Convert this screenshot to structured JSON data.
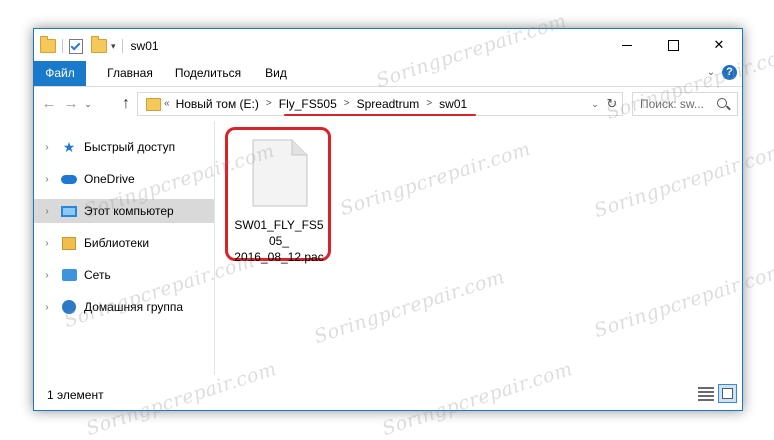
{
  "window": {
    "title": "sw01"
  },
  "ribbon": {
    "tabs": [
      {
        "label": "Файл",
        "active": true
      },
      {
        "label": "Главная"
      },
      {
        "label": "Поделиться"
      },
      {
        "label": "Вид"
      }
    ],
    "help": "?"
  },
  "address": {
    "lead": "«",
    "crumbs": [
      "Новый том (E:)",
      "Fly_FS505",
      "Spreadtrum",
      "sw01"
    ],
    "arrow": ">"
  },
  "search": {
    "placeholder": "Поиск: sw..."
  },
  "nav": {
    "items": [
      {
        "label": "Быстрый доступ",
        "icon": "star-icon"
      },
      {
        "label": "OneDrive",
        "icon": "cloud-icon"
      },
      {
        "label": "Этот компьютер",
        "icon": "computer-icon",
        "selected": true
      },
      {
        "label": "Библиотеки",
        "icon": "library-icon"
      },
      {
        "label": "Сеть",
        "icon": "network-icon"
      },
      {
        "label": "Домашняя группа",
        "icon": "homegroup-icon"
      }
    ]
  },
  "files": [
    {
      "name": "SW01_FLY_FS505_2016_08_12.pac",
      "name_lines": [
        "SW01_FLY_FS505_",
        "2016_08_12.pac"
      ],
      "icon": "document-file-icon"
    }
  ],
  "status": {
    "count": "1 элемент"
  },
  "watermark": "Soringpcrepair.com",
  "colors": {
    "accent": "#1979ca",
    "highlight": "#d8232a",
    "selection": "#d9d9d9"
  }
}
